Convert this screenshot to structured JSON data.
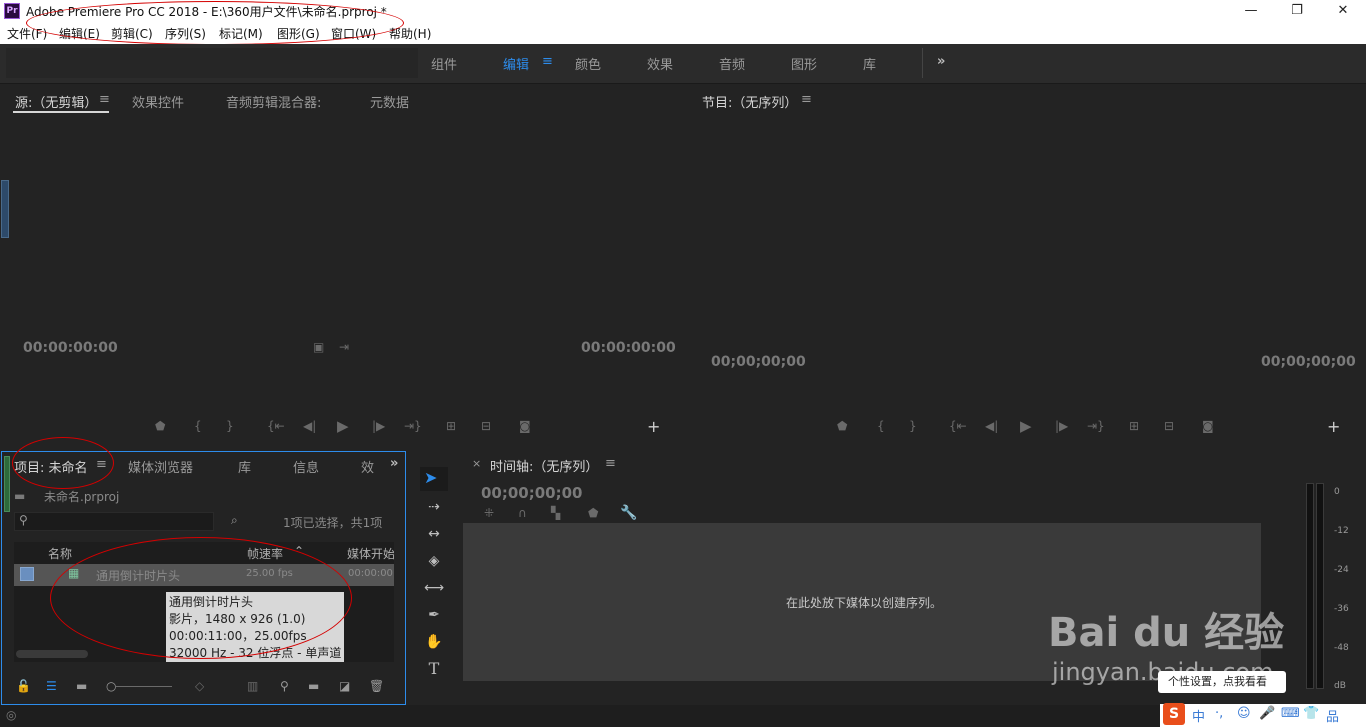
{
  "window": {
    "title": "Adobe Premiere Pro CC 2018 - E:\\360用户文件\\未命名.prproj *",
    "app_icon": "Pr"
  },
  "menu": [
    "文件(F)",
    "编辑(E)",
    "剪辑(C)",
    "序列(S)",
    "标记(M)",
    "图形(G)",
    "窗口(W)",
    "帮助(H)"
  ],
  "workspaces": [
    "组件",
    "编辑",
    "颜色",
    "效果",
    "音频",
    "图形",
    "库"
  ],
  "workspace_more": "»",
  "source_panel": {
    "tabs": [
      "源:（无剪辑）",
      "效果控件",
      "音频剪辑混合器:",
      "元数据"
    ],
    "timecode_left": "00:00:00:00",
    "timecode_right": "00:00:00:00"
  },
  "program_panel": {
    "tab": "节目:（无序列）",
    "timecode_left": "00;00;00;00",
    "timecode_right": "00;00;00;00"
  },
  "project_panel": {
    "tabs": [
      "项目: 未命名",
      "媒体浏览器",
      "库",
      "信息",
      "效"
    ],
    "file": "未命名.prproj",
    "selection_info": "1项已选择，共1项",
    "col_name": "名称",
    "col_fps": "帧速率",
    "col_start": "媒体开始",
    "item_name": "通用倒计时片头",
    "item_fps": "25.00 fps",
    "item_start": "00:00:00:",
    "tooltip": [
      "通用倒计时片头",
      "影片，1480 x 926 (1.0)",
      "00:00:11:00，25.00fps",
      "32000 Hz - 32 位浮点 - 单声道"
    ]
  },
  "timeline_panel": {
    "tab": "时间轴:（无序列）",
    "timecode": "00;00;00;00",
    "drop_hint": "在此处放下媒体以创建序列。"
  },
  "audio_meter": {
    "labels": [
      "0",
      "-12",
      "-24",
      "-36",
      "-48",
      "dB"
    ]
  },
  "watermark": {
    "brand": "Bai du 经验",
    "url": "jingyan.baidu.com",
    "notice": "个性设置，点我看看"
  },
  "tray": [
    "中",
    "·,",
    "☺",
    "🎤",
    "⌨",
    "👕",
    "品"
  ],
  "colors": {
    "accent": "#2d8ceb",
    "annotation": "#d40000",
    "bg": "#232323",
    "panel_border": "#1a1a1a"
  }
}
